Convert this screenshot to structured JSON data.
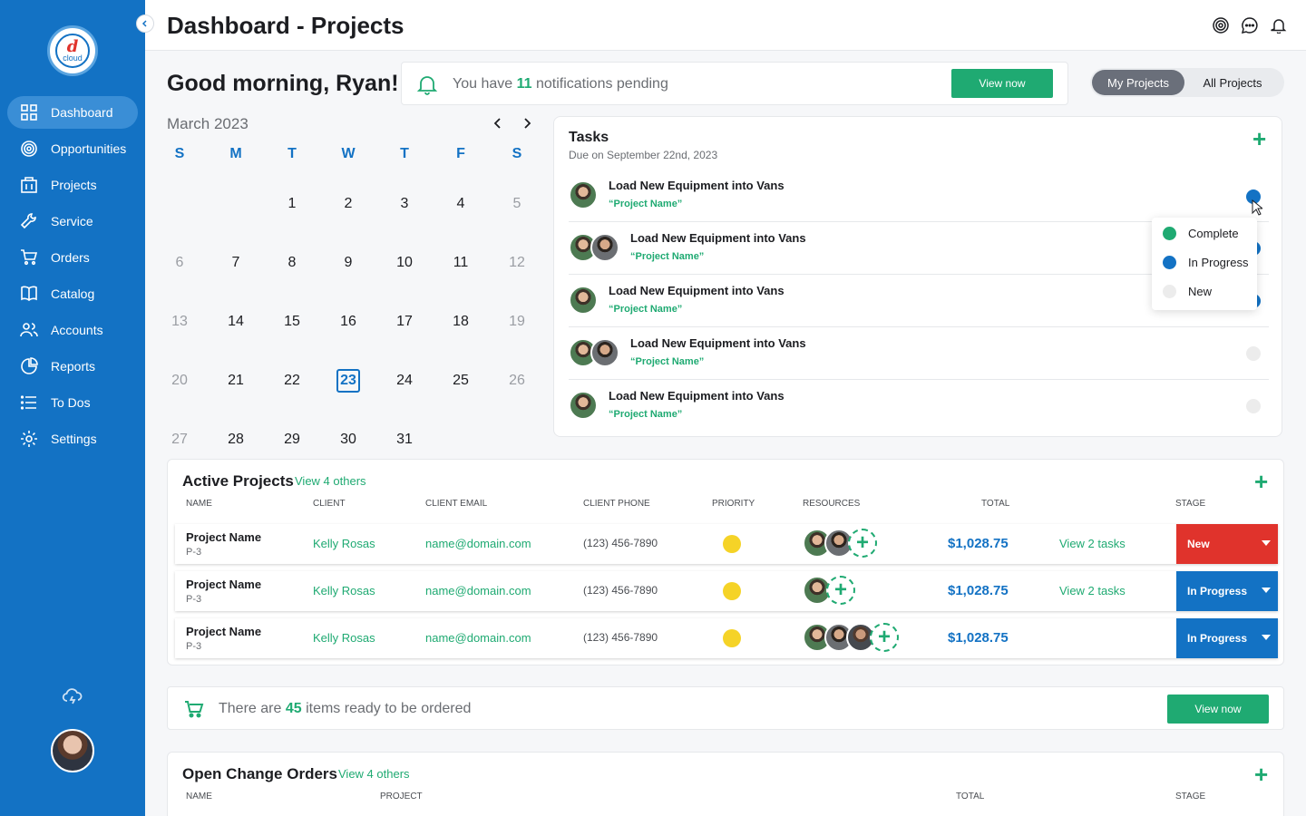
{
  "app": {
    "page_title": "Dashboard - Projects"
  },
  "sidebar": {
    "logo_letter": "d",
    "logo_text": "cloud",
    "items": [
      {
        "label": "Dashboard",
        "icon": "grid-icon",
        "active": true
      },
      {
        "label": "Opportunities",
        "icon": "target-icon"
      },
      {
        "label": "Projects",
        "icon": "building-icon"
      },
      {
        "label": "Service",
        "icon": "wrench-icon"
      },
      {
        "label": "Orders",
        "icon": "cart-icon"
      },
      {
        "label": "Catalog",
        "icon": "book-icon"
      },
      {
        "label": "Accounts",
        "icon": "users-icon"
      },
      {
        "label": "Reports",
        "icon": "pie-chart-icon"
      },
      {
        "label": "To Dos",
        "icon": "list-icon"
      },
      {
        "label": "Settings",
        "icon": "gear-icon"
      }
    ]
  },
  "greeting": "Good morning, Ryan!",
  "notifications": {
    "prefix": "You have",
    "count": "11",
    "suffix": "notifications pending",
    "button": "View now"
  },
  "project_toggle": {
    "mine": "My Projects",
    "all": "All Projects",
    "selected": "My Projects"
  },
  "calendar": {
    "month": "March 2023",
    "weekdays": [
      "S",
      "M",
      "T",
      "W",
      "T",
      "F",
      "S"
    ],
    "weeks": [
      [
        "",
        "",
        "1",
        "2",
        "3",
        "4",
        "5"
      ],
      [
        "6",
        "7",
        "8",
        "9",
        "10",
        "11",
        "12"
      ],
      [
        "13",
        "14",
        "15",
        "16",
        "17",
        "18",
        "19"
      ],
      [
        "20",
        "21",
        "22",
        "23",
        "24",
        "25",
        "26"
      ],
      [
        "27",
        "28",
        "29",
        "30",
        "31",
        "",
        ""
      ]
    ],
    "today": "23"
  },
  "tasks": {
    "title": "Tasks",
    "subtitle": "Due on September 22nd, 2023",
    "items": [
      {
        "name": "Load New Equipment into Vans",
        "project": "“Project Name”",
        "avatars": 1,
        "status": "In Progress"
      },
      {
        "name": "Load New Equipment into Vans",
        "project": "“Project Name”",
        "avatars": 2,
        "status": "In Progress"
      },
      {
        "name": "Load New Equipment into Vans",
        "project": "“Project Name”",
        "avatars": 1,
        "status": "In Progress"
      },
      {
        "name": "Load New Equipment into Vans",
        "project": "“Project Name”",
        "avatars": 2,
        "status": "New"
      },
      {
        "name": "Load New Equipment into Vans",
        "project": "“Project Name”",
        "avatars": 1,
        "status": "New"
      }
    ],
    "status_menu": [
      {
        "label": "Complete",
        "color": "#1faa72"
      },
      {
        "label": "In Progress",
        "color": "#1372c4"
      },
      {
        "label": "New",
        "color": "#ececec"
      }
    ]
  },
  "active_projects": {
    "title": "Active Projects",
    "link": "View 4 others",
    "columns": [
      "Name",
      "Client",
      "Client Email",
      "Client Phone",
      "Priority",
      "Resources",
      "Total",
      "Stage"
    ],
    "rows": [
      {
        "name": "Project Name",
        "code": "P-3",
        "client": "Kelly Rosas",
        "email": "name@domain.com",
        "phone": "(123) 456-7890",
        "resources": 2,
        "total": "$1,028.75",
        "tasks_link": "View 2 tasks",
        "stage": "New",
        "stage_color": "#e0332c"
      },
      {
        "name": "Project Name",
        "code": "P-3",
        "client": "Kelly Rosas",
        "email": "name@domain.com",
        "phone": "(123) 456-7890",
        "resources": 1,
        "total": "$1,028.75",
        "tasks_link": "View 2 tasks",
        "stage": "In Progress",
        "stage_color": "#1372c4"
      },
      {
        "name": "Project Name",
        "code": "P-3",
        "client": "Kelly Rosas",
        "email": "name@domain.com",
        "phone": "(123) 456-7890",
        "resources": 3,
        "total": "$1,028.75",
        "tasks_link": "",
        "stage": "In Progress",
        "stage_color": "#1372c4"
      }
    ]
  },
  "orders_ready": {
    "prefix": "There are",
    "count": "45",
    "suffix": "items ready to be ordered",
    "button": "View now"
  },
  "change_orders": {
    "title": "Open Change Orders",
    "link": "View 4 others",
    "columns": [
      "Name",
      "Project",
      "Total",
      "Stage"
    ]
  },
  "colors": {
    "brand": "#1372c4",
    "accent": "#1faa72",
    "danger": "#e0332c",
    "priority": "#f5d327"
  }
}
